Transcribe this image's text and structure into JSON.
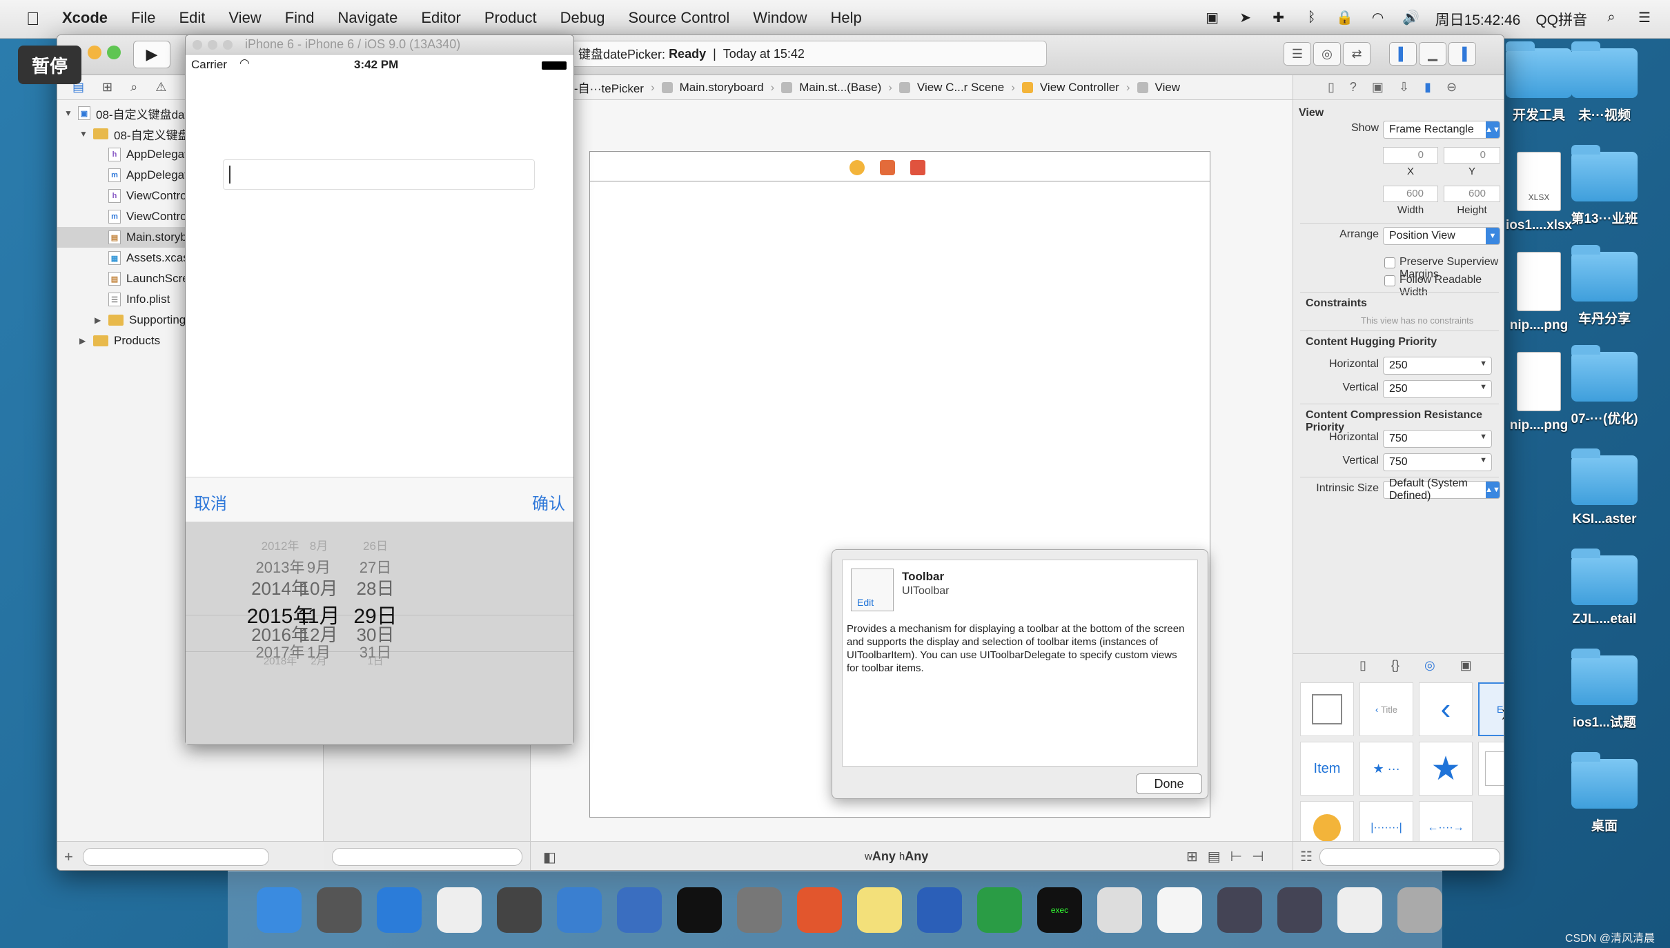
{
  "menubar": {
    "app": "Xcode",
    "menus": [
      "File",
      "Edit",
      "View",
      "Find",
      "Navigate",
      "Editor",
      "Product",
      "Debug",
      "Source Control",
      "Window",
      "Help"
    ],
    "clock": "周日15:42:46",
    "input_method": "QQ拼音"
  },
  "pause_badge": "暂停",
  "simulator": {
    "title": "iPhone 6 - iPhone 6 / iOS 9.0 (13A340)",
    "carrier": "Carrier",
    "time": "3:42 PM",
    "cancel": "取消",
    "confirm": "确认",
    "picker_rows": [
      [
        "2012年",
        "8月",
        "26日"
      ],
      [
        "2013年",
        "9月",
        "27日"
      ],
      [
        "2014年",
        "10月",
        "28日"
      ],
      [
        "2015年",
        "11月",
        "29日"
      ],
      [
        "2016年",
        "12月",
        "30日"
      ],
      [
        "2017年",
        "1月",
        "31日"
      ],
      [
        "2018年",
        "2月",
        "1日"
      ]
    ]
  },
  "status": {
    "project": "键盘datePicker:",
    "state": "Ready",
    "time": "Today at 15:42"
  },
  "navigator": {
    "items": [
      {
        "label": "08-自定义键盘dat",
        "icon": "project",
        "level": 0,
        "open": true
      },
      {
        "label": "08-自定义键盘d",
        "icon": "folder",
        "level": 1,
        "open": true
      },
      {
        "label": "AppDelegat",
        "icon": "h",
        "level": 2
      },
      {
        "label": "AppDelegat",
        "icon": "m",
        "level": 2
      },
      {
        "label": "ViewContro",
        "icon": "h",
        "level": 2
      },
      {
        "label": "ViewContro",
        "icon": "m",
        "level": 2
      },
      {
        "label": "Main.storyb",
        "icon": "sb",
        "level": 2,
        "selected": true
      },
      {
        "label": "Assets.xcas",
        "icon": "asset",
        "level": 2
      },
      {
        "label": "LaunchScre",
        "icon": "sb",
        "level": 2
      },
      {
        "label": "Info.plist",
        "icon": "plist",
        "level": 2
      },
      {
        "label": "Supporting",
        "icon": "folder",
        "level": 2,
        "closed": true
      },
      {
        "label": "Products",
        "icon": "folder",
        "level": 1,
        "closed": true
      }
    ]
  },
  "jumpbar": [
    "08-自···tePicker",
    "Main.storyboard",
    "Main.st...(Base)",
    "View C...r Scene",
    "View Controller",
    "View"
  ],
  "canvas": {
    "size_class_w": "Any",
    "size_class_h": "Any",
    "w_prefix": "w",
    "h_prefix": "h"
  },
  "popover": {
    "icon_label": "Edit",
    "title": "Toolbar",
    "subtitle": "UIToolbar",
    "description": "Provides a mechanism for displaying a toolbar at the bottom of the screen and supports the display and selection of toolbar items (instances of UIToolbarItem). You can use UIToolbarDelegate to specify custom views for toolbar items.",
    "done": "Done"
  },
  "inspector": {
    "section": "View",
    "show_label": "Show",
    "show_value": "Frame Rectangle",
    "x": "0",
    "y": "0",
    "x_cap": "X",
    "y_cap": "Y",
    "width": "600",
    "height": "600",
    "w_cap": "Width",
    "h_cap": "Height",
    "arrange_label": "Arrange",
    "arrange_value": "Position View",
    "preserve": "Preserve Superview Margins",
    "readable": "Follow Readable Width",
    "constraints": "Constraints",
    "no_constraints": "This view has no constraints",
    "hugging": "Content Hugging Priority",
    "horizontal_label": "Horizontal",
    "vertical_label": "Vertical",
    "hug_h": "250",
    "hug_v": "250",
    "compression": "Content Compression Resistance Priority",
    "comp_h": "750",
    "comp_v": "750",
    "intrinsic_label": "Intrinsic Size",
    "intrinsic_value": "Default (System Defined)"
  },
  "library": {
    "item_label": "Item",
    "title_label": "Title",
    "edit_label": "Edit"
  },
  "desktop": {
    "icons": [
      {
        "label": "开发工具",
        "type": "folder"
      },
      {
        "label": "未···视频",
        "type": "folder"
      },
      {
        "label": "ios1....xlsx",
        "type": "file"
      },
      {
        "label": "第13···业班",
        "type": "folder"
      },
      {
        "label": "nip....png",
        "type": "file"
      },
      {
        "label": "车丹分享",
        "type": "folder"
      },
      {
        "label": "nip....png",
        "type": "file"
      },
      {
        "label": "07-···(优化)",
        "type": "folder"
      },
      {
        "label": "KSI...aster",
        "type": "folder"
      },
      {
        "label": "ZJL....etail",
        "type": "folder"
      },
      {
        "label": "ios1...试题",
        "type": "folder"
      },
      {
        "label": "桌面",
        "type": "folder"
      }
    ],
    "xlsx_badge": "XLSX"
  },
  "dock": [
    "finder-icon",
    "launchpad-icon",
    "safari-icon",
    "mouse-icon",
    "preview-icon",
    "xcode-icon",
    "instruments-icon",
    "terminal-icon",
    "system-preferences-icon",
    "powerpoint-icon",
    "notes-icon",
    "word-icon",
    "excel-icon",
    "exec-icon",
    "window-icon",
    "file-icon",
    "screen-icon",
    "screen-icon",
    "preview-icon",
    "trash-icon"
  ],
  "dock_exec_label": "exec",
  "watermark": "CSDN @清风清晨"
}
